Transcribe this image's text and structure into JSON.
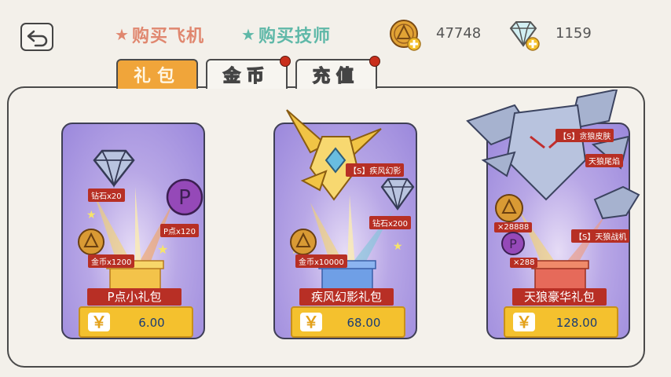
{
  "header": {
    "tab_buy_plane": "购买飞机",
    "tab_buy_mechanic": "购买技师",
    "coins": "47748",
    "gems": "1159"
  },
  "tabs": [
    {
      "label": "礼包",
      "active": true,
      "dot": false
    },
    {
      "label": "金币",
      "active": false,
      "dot": true
    },
    {
      "label": "充值",
      "active": false,
      "dot": true
    }
  ],
  "packs": [
    {
      "name": "P点小礼包",
      "price": "6.00",
      "currency_symbol": "￥",
      "items": [
        "钻石x20",
        "P点x120",
        "金币x1200"
      ]
    },
    {
      "name": "疾风幻影礼包",
      "price": "68.00",
      "currency_symbol": "￥",
      "items": [
        "【S】疾风幻影",
        "钻石x200",
        "金币x10000"
      ]
    },
    {
      "name": "天狼豪华礼包",
      "price": "128.00",
      "currency_symbol": "￥",
      "items": [
        "【S】贪狼皮肤",
        "天狼尾焰",
        "×28888",
        "【S】天狼战机",
        "×288"
      ]
    }
  ],
  "colors": {
    "accent_orange": "#f0a53a",
    "tag_red": "#b72f24",
    "price_yellow": "#f4c12e",
    "card_purple": "#9b88dc",
    "plane_tab_pink": "#e0876f",
    "mechanic_tab_teal": "#5fb8a8"
  },
  "icons": [
    "back-arrow-icon",
    "star-icon",
    "coin-plus-icon",
    "gem-plus-icon",
    "diamond-icon",
    "p-point-icon",
    "coin-icon",
    "plane-icon",
    "gift-box-icon",
    "yen-icon"
  ]
}
